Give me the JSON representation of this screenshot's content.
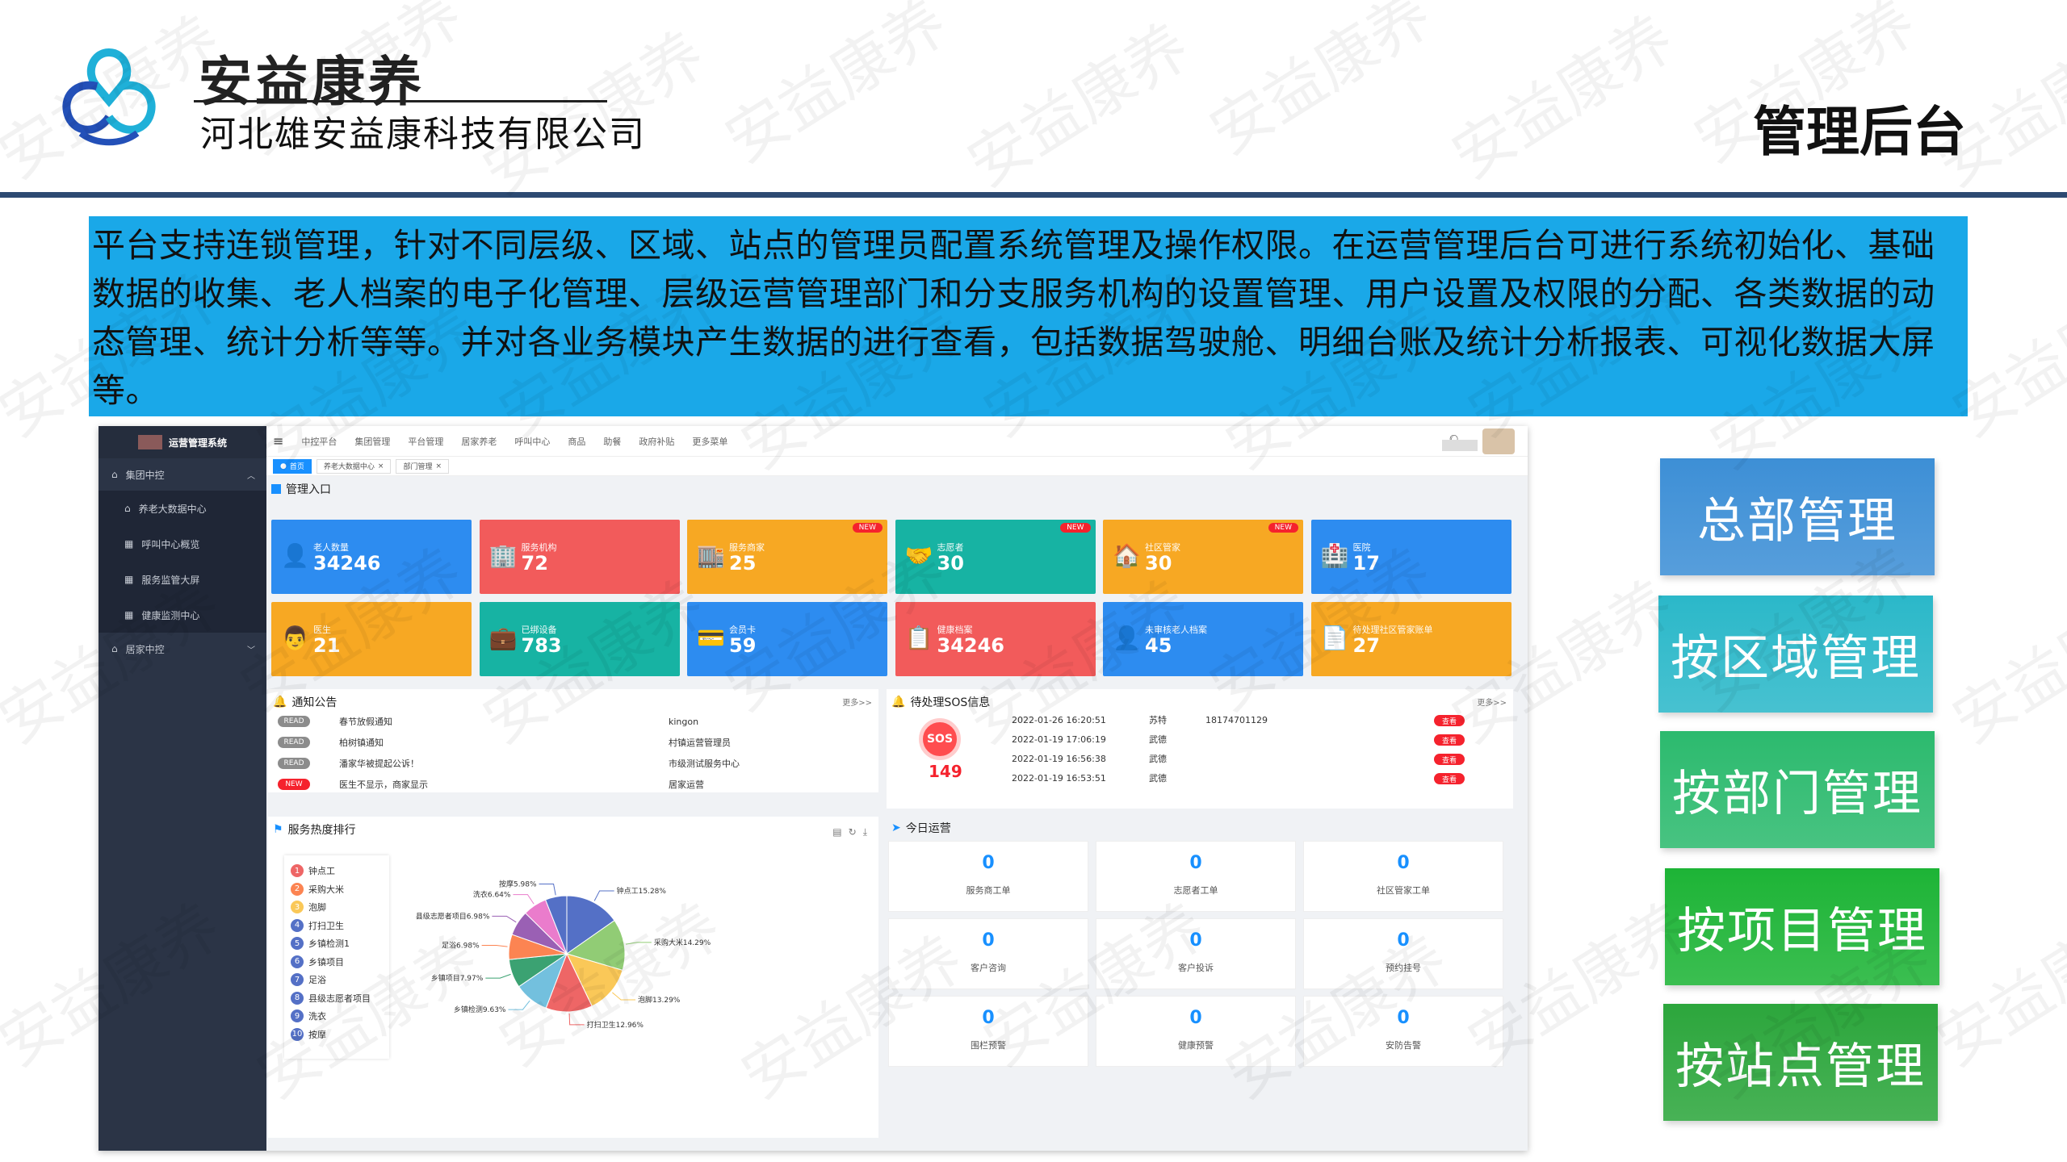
{
  "header": {
    "brand_name": "安益康养",
    "company_name": "河北雄安益康科技有限公司",
    "page_title": "管理后台"
  },
  "watermark_text": "安益康养",
  "intro_text": " 平台支持连锁管理，针对不同层级、区域、站点的管理员配置系统管理及操作权限。在运营管理后台可进行系统初始化、基础数据的收集、老人档案的电子化管理、层级运营管理部门和分支服务机构的设置管理、用户设置及权限的分配、各类数据的动态管理、统计分析等等。并对各业务模块产生数据的进行查看，包括数据驾驶舱、明细台账及统计分析报表、可视化数据大屏等。",
  "right_nav": [
    {
      "label": "总部管理",
      "color": "#3d8fd6"
    },
    {
      "label": "按区域管理",
      "color": "#2bb8c9"
    },
    {
      "label": "按部门管理",
      "color": "#2cba6e"
    },
    {
      "label": "按项目管理",
      "color": "#1db436"
    },
    {
      "label": "按站点管理",
      "color": "#2ca63c"
    }
  ],
  "dashboard": {
    "system_name": "运营管理系统",
    "sidebar": {
      "groups": [
        {
          "label": "集团中控",
          "items": [
            "养老大数据中心",
            "呼叫中心概览",
            "服务监管大屏",
            "健康监测中心"
          ]
        },
        {
          "label": "居家中控",
          "items": []
        }
      ]
    },
    "topnav": [
      "中控平台",
      "集团管理",
      "平台管理",
      "居家养老",
      "呼叫中心",
      "商品",
      "助餐",
      "政府补贴",
      "更多菜单"
    ],
    "tabs": [
      "首页",
      "养老大数据中心",
      "部门管理"
    ],
    "entry_title": "管理入口",
    "cards": [
      {
        "label": "老人数量",
        "value": "34246",
        "color": "#2d8cf0",
        "icon": "👤",
        "new": ""
      },
      {
        "label": "服务机构",
        "value": "72",
        "color": "#f25b5b",
        "icon": "🏢",
        "new": ""
      },
      {
        "label": "服务商家",
        "value": "25",
        "color": "#f7a823",
        "icon": "🏬",
        "new": "NEW"
      },
      {
        "label": "志愿者",
        "value": "30",
        "color": "#17b3a3",
        "icon": "🤝",
        "new": "NEW"
      },
      {
        "label": "社区管家",
        "value": "30",
        "color": "#f7a823",
        "icon": "🏠",
        "new": "NEW"
      },
      {
        "label": "医院",
        "value": "17",
        "color": "#2d8cf0",
        "icon": "🏥",
        "new": ""
      },
      {
        "label": "医生",
        "value": "21",
        "color": "#f7a823",
        "icon": "👨",
        "new": ""
      },
      {
        "label": "已绑设备",
        "value": "783",
        "color": "#17b3a3",
        "icon": "💼",
        "new": ""
      },
      {
        "label": "会员卡",
        "value": "59",
        "color": "#2d8cf0",
        "icon": "💳",
        "new": ""
      },
      {
        "label": "健康档案",
        "value": "34246",
        "color": "#f25b5b",
        "icon": "📋",
        "new": ""
      },
      {
        "label": "未审核老人档案",
        "value": "45",
        "color": "#2d8cf0",
        "icon": "👤",
        "new": ""
      },
      {
        "label": "待处理社区管家账单",
        "value": "27",
        "color": "#f7a823",
        "icon": "📄",
        "new": ""
      }
    ],
    "notice": {
      "title": "通知公告",
      "more": "更多>>",
      "rows": [
        {
          "badge": "READ",
          "title": "春节放假通知",
          "author": "kingon"
        },
        {
          "badge": "READ",
          "title": "柏树镇通知",
          "author": "村镇运营管理员"
        },
        {
          "badge": "READ",
          "title": "潘家华被提起公诉！",
          "author": "市级测试服务中心"
        },
        {
          "badge": "NEW",
          "title": "医生不显示，商家显示",
          "author": "居家运营"
        }
      ]
    },
    "sos": {
      "title": "待处理SOS信息",
      "more": "更多>>",
      "label": "SOS",
      "count": "149",
      "btn": "查看",
      "rows": [
        {
          "time": "2022-01-26 16:20:51",
          "name": "苏特",
          "phone": "18174701129"
        },
        {
          "time": "2022-01-19 17:06:19",
          "name": "武德",
          "phone": ""
        },
        {
          "time": "2022-01-19 16:56:38",
          "name": "武德",
          "phone": ""
        },
        {
          "time": "2022-01-19 16:53:51",
          "name": "武德",
          "phone": ""
        }
      ]
    },
    "ranking_title": "服务热度排行",
    "today_title": "今日运营",
    "today": [
      {
        "value": "0",
        "label": "服务商工单"
      },
      {
        "value": "0",
        "label": "志愿者工单"
      },
      {
        "value": "0",
        "label": "社区管家工单"
      },
      {
        "value": "0",
        "label": "客户咨询"
      },
      {
        "value": "0",
        "label": "客户投诉"
      },
      {
        "value": "0",
        "label": "预约挂号"
      },
      {
        "value": "0",
        "label": "围栏预警"
      },
      {
        "value": "0",
        "label": "健康预警"
      },
      {
        "value": "0",
        "label": "安防告警"
      }
    ]
  },
  "chart_data": {
    "type": "pie",
    "title": "服务热度排行",
    "categories": [
      "钟点工",
      "采购大米",
      "泡脚",
      "打扫卫生",
      "乡镇检测1",
      "乡镇项目",
      "足浴",
      "县级志愿者项目",
      "洗衣",
      "按摩"
    ],
    "values": [
      15.28,
      14.29,
      13.29,
      12.96,
      9.63,
      7.97,
      6.98,
      6.98,
      6.64,
      5.98
    ],
    "labels": [
      "钟点工15.28%",
      "采购大米14.29%",
      "泡脚13.29%",
      "打扫卫生12.96%",
      "乡镇检测9.63%",
      "乡镇项目7.97%",
      "足浴6.98%",
      "县级志愿者项目6.98%",
      "洗衣6.64%",
      "按摩5.98%"
    ],
    "colors": [
      "#5470c6",
      "#91cc75",
      "#fac858",
      "#ee6666",
      "#73c0de",
      "#3ba272",
      "#fc8452",
      "#9a60b4",
      "#ea7ccc",
      "#5470c6"
    ],
    "legend_colors": [
      "#ee6666",
      "#fc8452",
      "#fac858",
      "#5470c6",
      "#5470c6",
      "#5470c6",
      "#5470c6",
      "#5470c6",
      "#5470c6",
      "#5470c6"
    ]
  }
}
